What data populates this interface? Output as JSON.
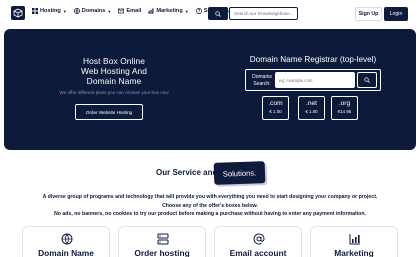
{
  "nav": {
    "menu": [
      {
        "label": "Hosting",
        "icon": "grid-icon",
        "dropdown": true
      },
      {
        "label": "Domains",
        "icon": "globe-icon",
        "dropdown": true
      },
      {
        "label": "Email",
        "icon": "mail-icon",
        "dropdown": false
      },
      {
        "label": "Marketing",
        "icon": "chart-icon",
        "dropdown": true
      },
      {
        "label": "Support",
        "icon": "help-icon",
        "dropdown": true
      }
    ],
    "search_placeholder": "Search our knowledgebase...",
    "signup_label": "Sign Up",
    "login_label": "Login"
  },
  "hero": {
    "title_lines": [
      "Host Box Online",
      "Web Hosting And",
      "Domain Name"
    ],
    "subtitle": "We offer different plans you can choose your box now",
    "order_button": "Order Website Hosting",
    "registrar_title": "Domain Name Registrar (top-level)",
    "domain_label_line1": "Domains",
    "domain_label_line2": "Search:",
    "domain_placeholder": "eg: example.com",
    "tlds": [
      {
        "ext": ".com",
        "price": "€ 1.00"
      },
      {
        "ext": ".net",
        "price": "€ 1.00"
      },
      {
        "ext": ".org",
        "price": "€14.95"
      }
    ]
  },
  "services": {
    "title": "Our Service and",
    "badge": "Solutions.",
    "desc_lines": [
      "A diverse group of programs and technology that will provide you with everything you need to start designing your company or project.",
      "Choose any of the offer's boxes below.",
      "No ads, no banners, no cookies to try our product before making a purchase without having to enter any payment information."
    ],
    "cards": [
      {
        "title": "Domain Name",
        "icon": "globe-icon"
      },
      {
        "title": "Order hosting",
        "icon": "server-icon"
      },
      {
        "title": "Email account",
        "icon": "at-icon"
      },
      {
        "title": "Marketing",
        "icon": "chart-icon"
      }
    ]
  },
  "colors": {
    "navy": "#0e1a3b",
    "white": "#ffffff",
    "muted": "#8a93ad"
  }
}
